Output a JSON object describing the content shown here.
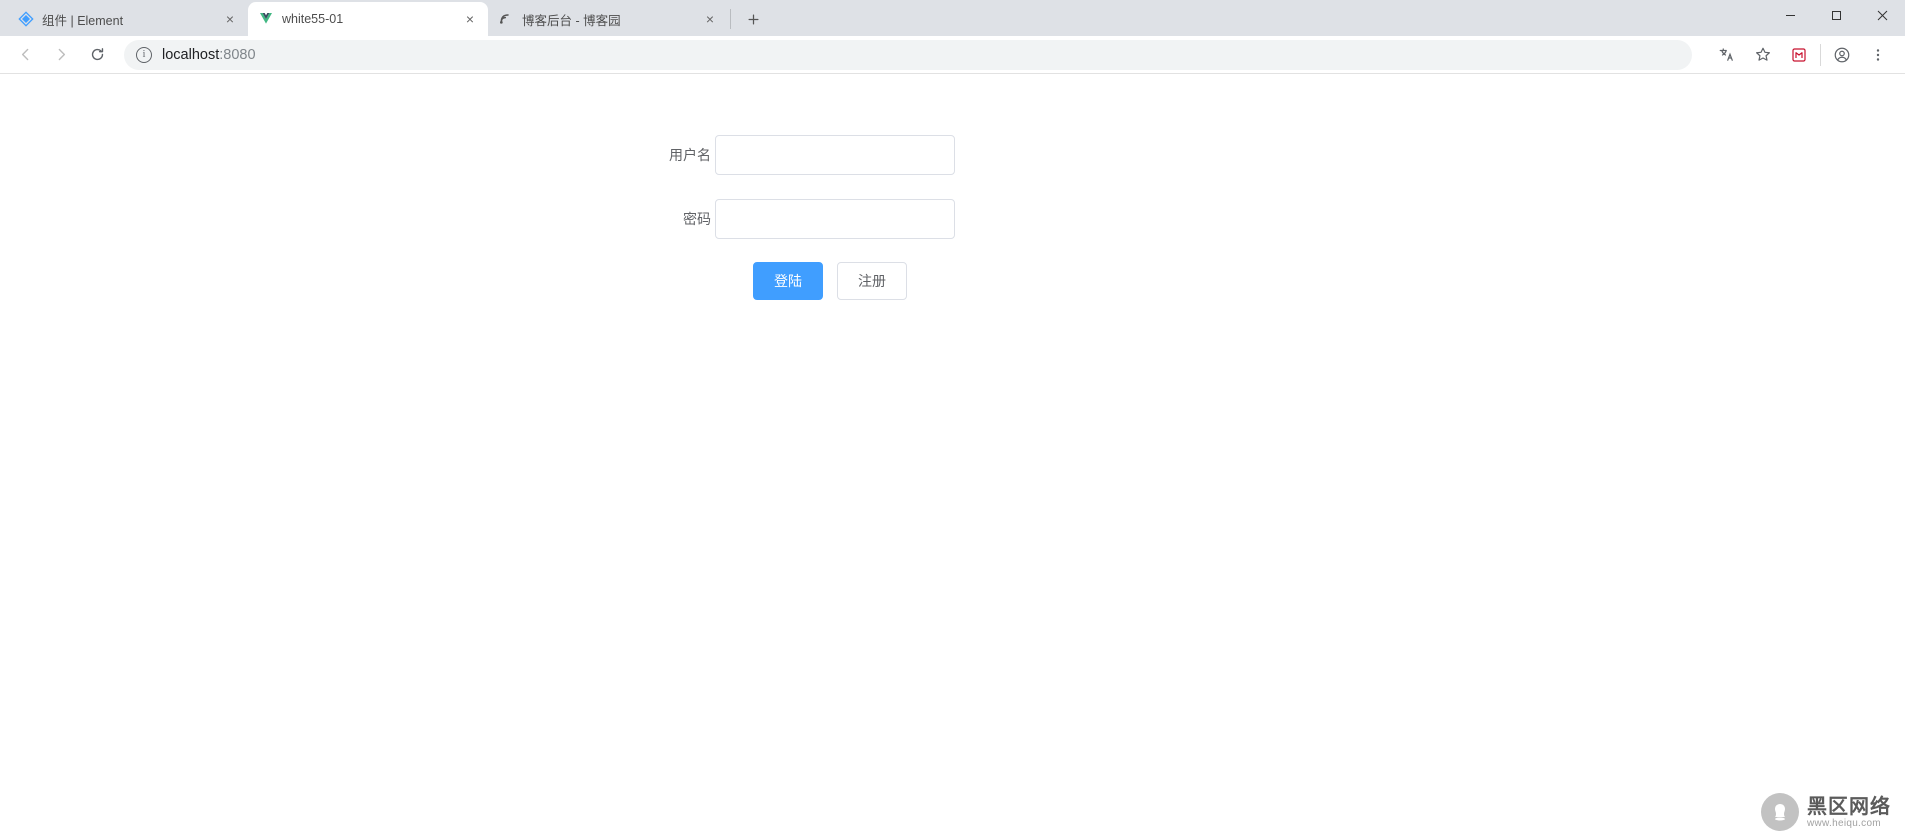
{
  "browser": {
    "tabs": [
      {
        "title": "组件 | Element",
        "favicon": "element-logo"
      },
      {
        "title": "white55-01",
        "favicon": "vue-logo"
      },
      {
        "title": "博客后台 - 博客园",
        "favicon": "cnblogs-logo"
      }
    ],
    "active_tab_index": 1,
    "url": {
      "host": "localhost",
      "port": ":8080"
    }
  },
  "form": {
    "username": {
      "label": "用户名",
      "value": ""
    },
    "password": {
      "label": "密码",
      "value": ""
    },
    "login_button": "登陆",
    "register_button": "注册"
  },
  "watermark": {
    "main": "黑区网络",
    "sub": "www.heiqu.com"
  }
}
